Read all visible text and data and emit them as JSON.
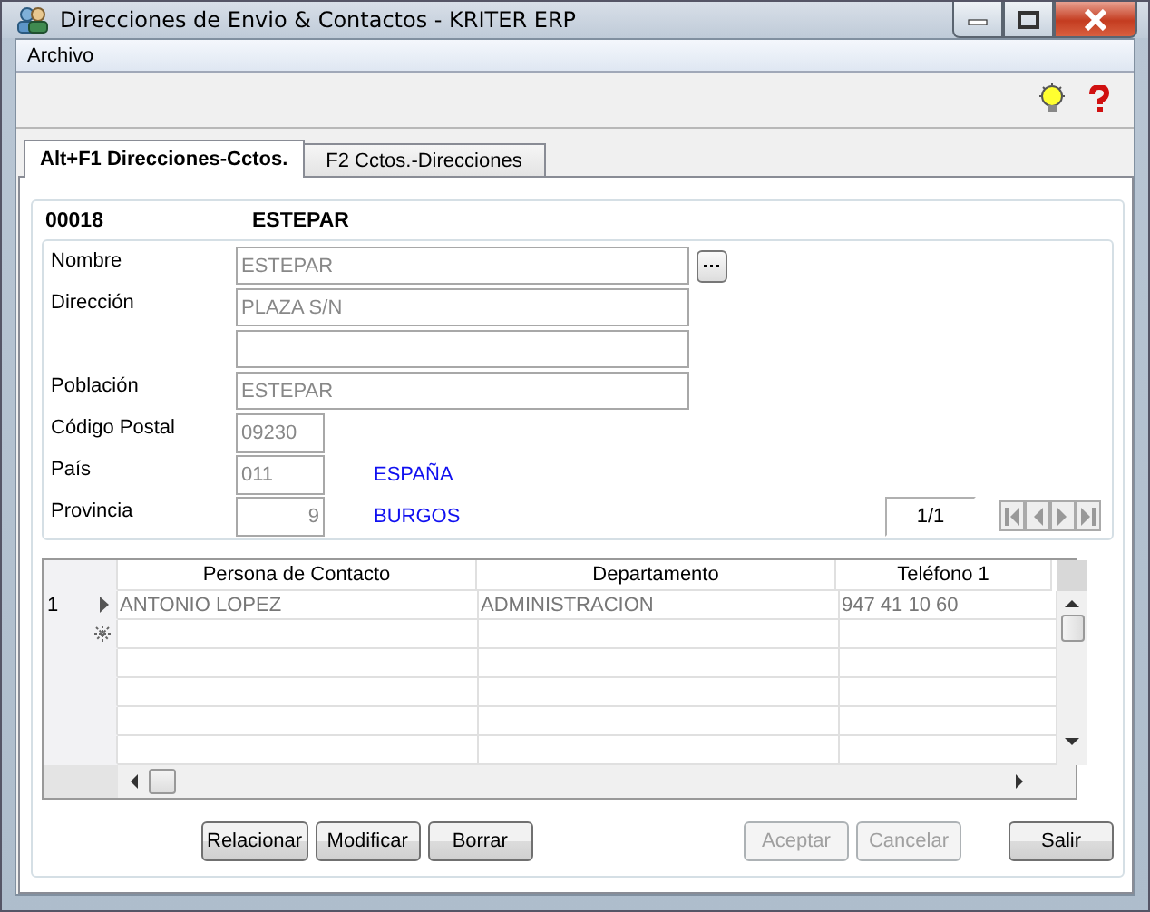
{
  "window": {
    "title": "Direcciones de Envio & Contactos - KRITER ERP"
  },
  "menu": [
    "Archivo"
  ],
  "tabs": [
    {
      "label": "Alt+F1 Direcciones-Cctos.",
      "selected": true
    },
    {
      "label": "F2 Cctos.-Direcciones",
      "selected": false
    }
  ],
  "record": {
    "code": "00018",
    "name": "ESTEPAR"
  },
  "fields": [
    {
      "kind": "wide",
      "label": "Nombre",
      "value": "ESTEPAR",
      "browse": true
    },
    {
      "kind": "wide",
      "label": "Dirección",
      "value": "PLAZA S/N"
    },
    {
      "kind": "wide"
    },
    {
      "kind": "wide",
      "label": "Población",
      "value": "ESTEPAR"
    },
    {
      "kind": "short",
      "label": "Código Postal",
      "value": "09230"
    },
    {
      "kind": "short",
      "label": "País",
      "value": "011",
      "description": "ESPAÑA"
    },
    {
      "kind": "numeric",
      "label": "Provincia",
      "value": "9",
      "description": "BURGOS"
    }
  ],
  "pager": "1/1",
  "table": {
    "columns": [
      "Persona de Contacto",
      "Departamento",
      "Teléfono 1"
    ],
    "rows": [
      {
        "number": "1",
        "current": true,
        "cells": [
          "ANTONIO LOPEZ",
          "ADMINISTRACION",
          "947 41 10 60"
        ]
      }
    ]
  },
  "buttons": [
    {
      "label": "Relacionar",
      "disabled": false
    },
    {
      "label": "Modificar",
      "disabled": false
    },
    {
      "label": "Borrar",
      "disabled": false
    },
    {
      "label": "Aceptar",
      "disabled": true
    },
    {
      "label": "Cancelar",
      "disabled": true
    },
    {
      "label": "Salir",
      "disabled": false
    }
  ]
}
